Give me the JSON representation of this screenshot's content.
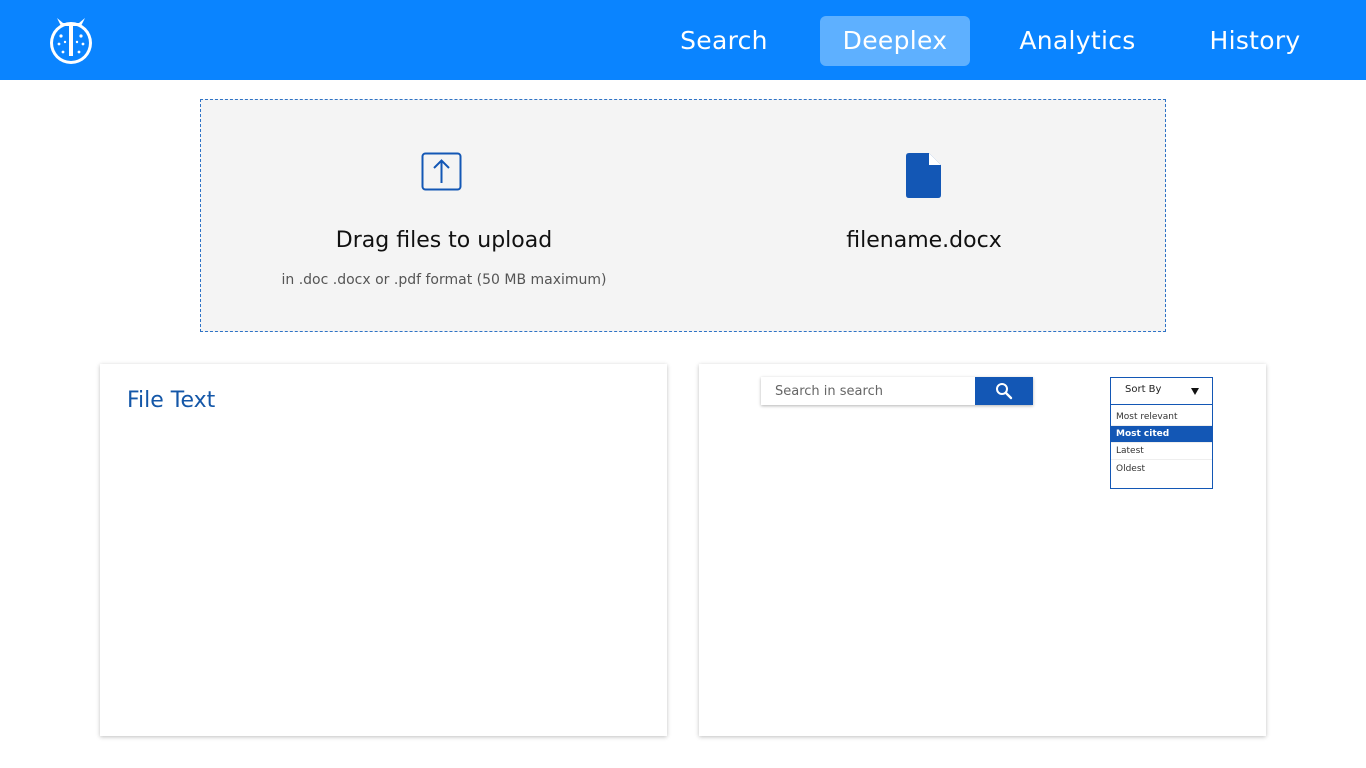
{
  "nav": {
    "items": [
      {
        "label": "Search"
      },
      {
        "label": "Deeplex"
      },
      {
        "label": "Analytics"
      },
      {
        "label": "History"
      }
    ],
    "active": "Deeplex",
    "logo_icon": "owl-logo-icon"
  },
  "upload": {
    "title": "Drag files to upload",
    "subtitle": "in .doc .docx or .pdf format (50 MB maximum)",
    "icon": "upload-arrow-icon",
    "file_name": "filename.docx",
    "file_icon": "document-icon"
  },
  "file_text_panel": {
    "title": "File Text"
  },
  "results_panel": {
    "search": {
      "placeholder": "Search in search",
      "value": "",
      "icon": "search-icon"
    },
    "sort": {
      "label": "Sort By",
      "options": [
        "Most relevant",
        "Most cited",
        "Latest",
        "Oldest"
      ],
      "selected": "Most cited"
    }
  },
  "colors": {
    "topbar": "#0a84ff",
    "nav_active": "#5eb0ff",
    "accent": "#1357b5",
    "dropzone_bg": "#f4f4f4"
  }
}
